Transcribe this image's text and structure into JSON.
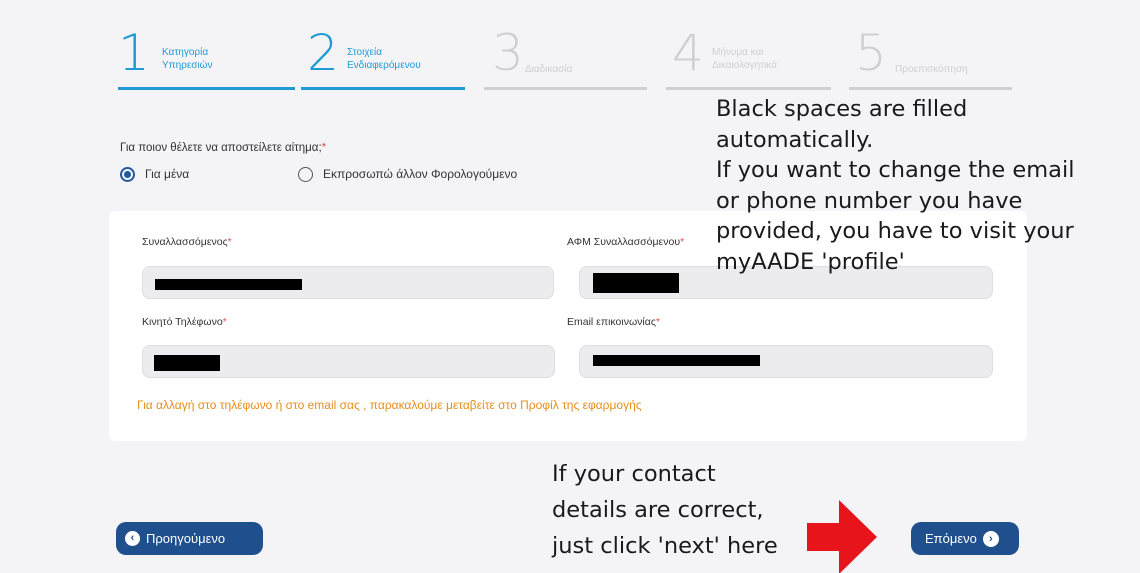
{
  "stepper": {
    "steps": [
      {
        "number": "1",
        "label": "Κατηγορία\nΥπηρεσιών",
        "state": "active"
      },
      {
        "number": "2",
        "label": "Στοιχεία\nΕνδιαφερόμενου",
        "state": "active"
      },
      {
        "number": "3",
        "label": "Διαδικασία",
        "state": "inactive"
      },
      {
        "number": "4",
        "label": "Μήνυμα και\nΔικαιολογητικά",
        "state": "inactive"
      },
      {
        "number": "5",
        "label": "Προεπισκόπηση",
        "state": "inactive"
      }
    ]
  },
  "question": {
    "text": "Για ποιον θέλετε να αποστείλετε αίτημα;",
    "required_mark": "*",
    "options": [
      {
        "label": "Για μένα",
        "checked": true
      },
      {
        "label": "Εκπροσωπώ άλλον Φορολογούμενο",
        "checked": false
      }
    ]
  },
  "form": {
    "fields": [
      {
        "label": "Συναλλασσόμενος",
        "required_mark": "*"
      },
      {
        "label": "ΑΦΜ Συναλλασσόμενου",
        "required_mark": "*"
      },
      {
        "label": "Κινητό Τηλέφωνο",
        "required_mark": "*"
      },
      {
        "label": "Email επικοινωνίας",
        "required_mark": "*"
      }
    ],
    "hint": "Για αλλαγή στο τηλέφωνο ή στο email σας , παρακαλούμε μεταβείτε στο Προφίλ της εφαρμογής"
  },
  "annotations": {
    "top": "Black spaces are filled\nautomatically.\nIf you want to change the email\nor phone number you have\nprovided, you have to visit your\nmyAADE 'profile'",
    "bottom": "If your contact\ndetails are correct,\njust click 'next' here"
  },
  "buttons": {
    "prev_label": "Προηγούμενο",
    "next_label": "Επόμενο"
  },
  "colors": {
    "active_step": "#1e9ad6",
    "inactive_step": "#cfcfd3",
    "button": "#1f4f8d",
    "hint": "#e58e1a",
    "required": "#d9534f",
    "arrow": "#e8141c"
  }
}
